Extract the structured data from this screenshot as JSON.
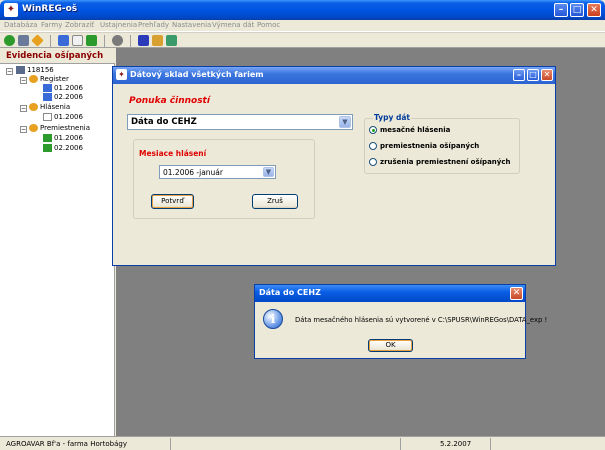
{
  "app": {
    "title": "WinREG-oš",
    "icon_glyph": "✦"
  },
  "menu": [
    "Databáza",
    "Farmy",
    "Zobraziť",
    "Ustajnenia",
    "Prehľady",
    "Nastavenia",
    "Výmena dát",
    "Pomoc"
  ],
  "left_panel": {
    "header": "Evidencia ošípaných",
    "tree": {
      "root": "118156",
      "register_label": "Register",
      "register_items": [
        "01.2006",
        "02.2006"
      ],
      "hlasenia_label": "Hlásenia",
      "hlasenia_items": [
        "01.2006"
      ],
      "premiestnenia_label": "Premiestnenia",
      "premiestnenia_items": [
        "01.2006",
        "02.2006"
      ]
    }
  },
  "status": {
    "left": "AGROAVAR Bf'a - farma Hortobágy",
    "right": "5.2.2007"
  },
  "child_window": {
    "title": "Dátový sklad všetkých fariem",
    "ponuka_label": "Ponuka činností",
    "activity_value": "Dáta do CEHZ",
    "mesiace_label": "Mesiace hlásení",
    "month_value": "01.2006 -január",
    "confirm_label": "Potvrď",
    "cancel_label": "Zruš",
    "typy_label": "Typy dát",
    "radio_options": [
      "mesačné hlásenia",
      "premiestnenia ošípaných",
      "zrušenia premiestnení ošípaných"
    ],
    "selected_radio": 0
  },
  "dialog": {
    "title": "Dáta do CEHZ",
    "message": "Dáta mesačného hlásenia sú vytvorené v C:\\SPUSR\\WinREGos\\DATA_exp !",
    "ok_label": "OK"
  }
}
